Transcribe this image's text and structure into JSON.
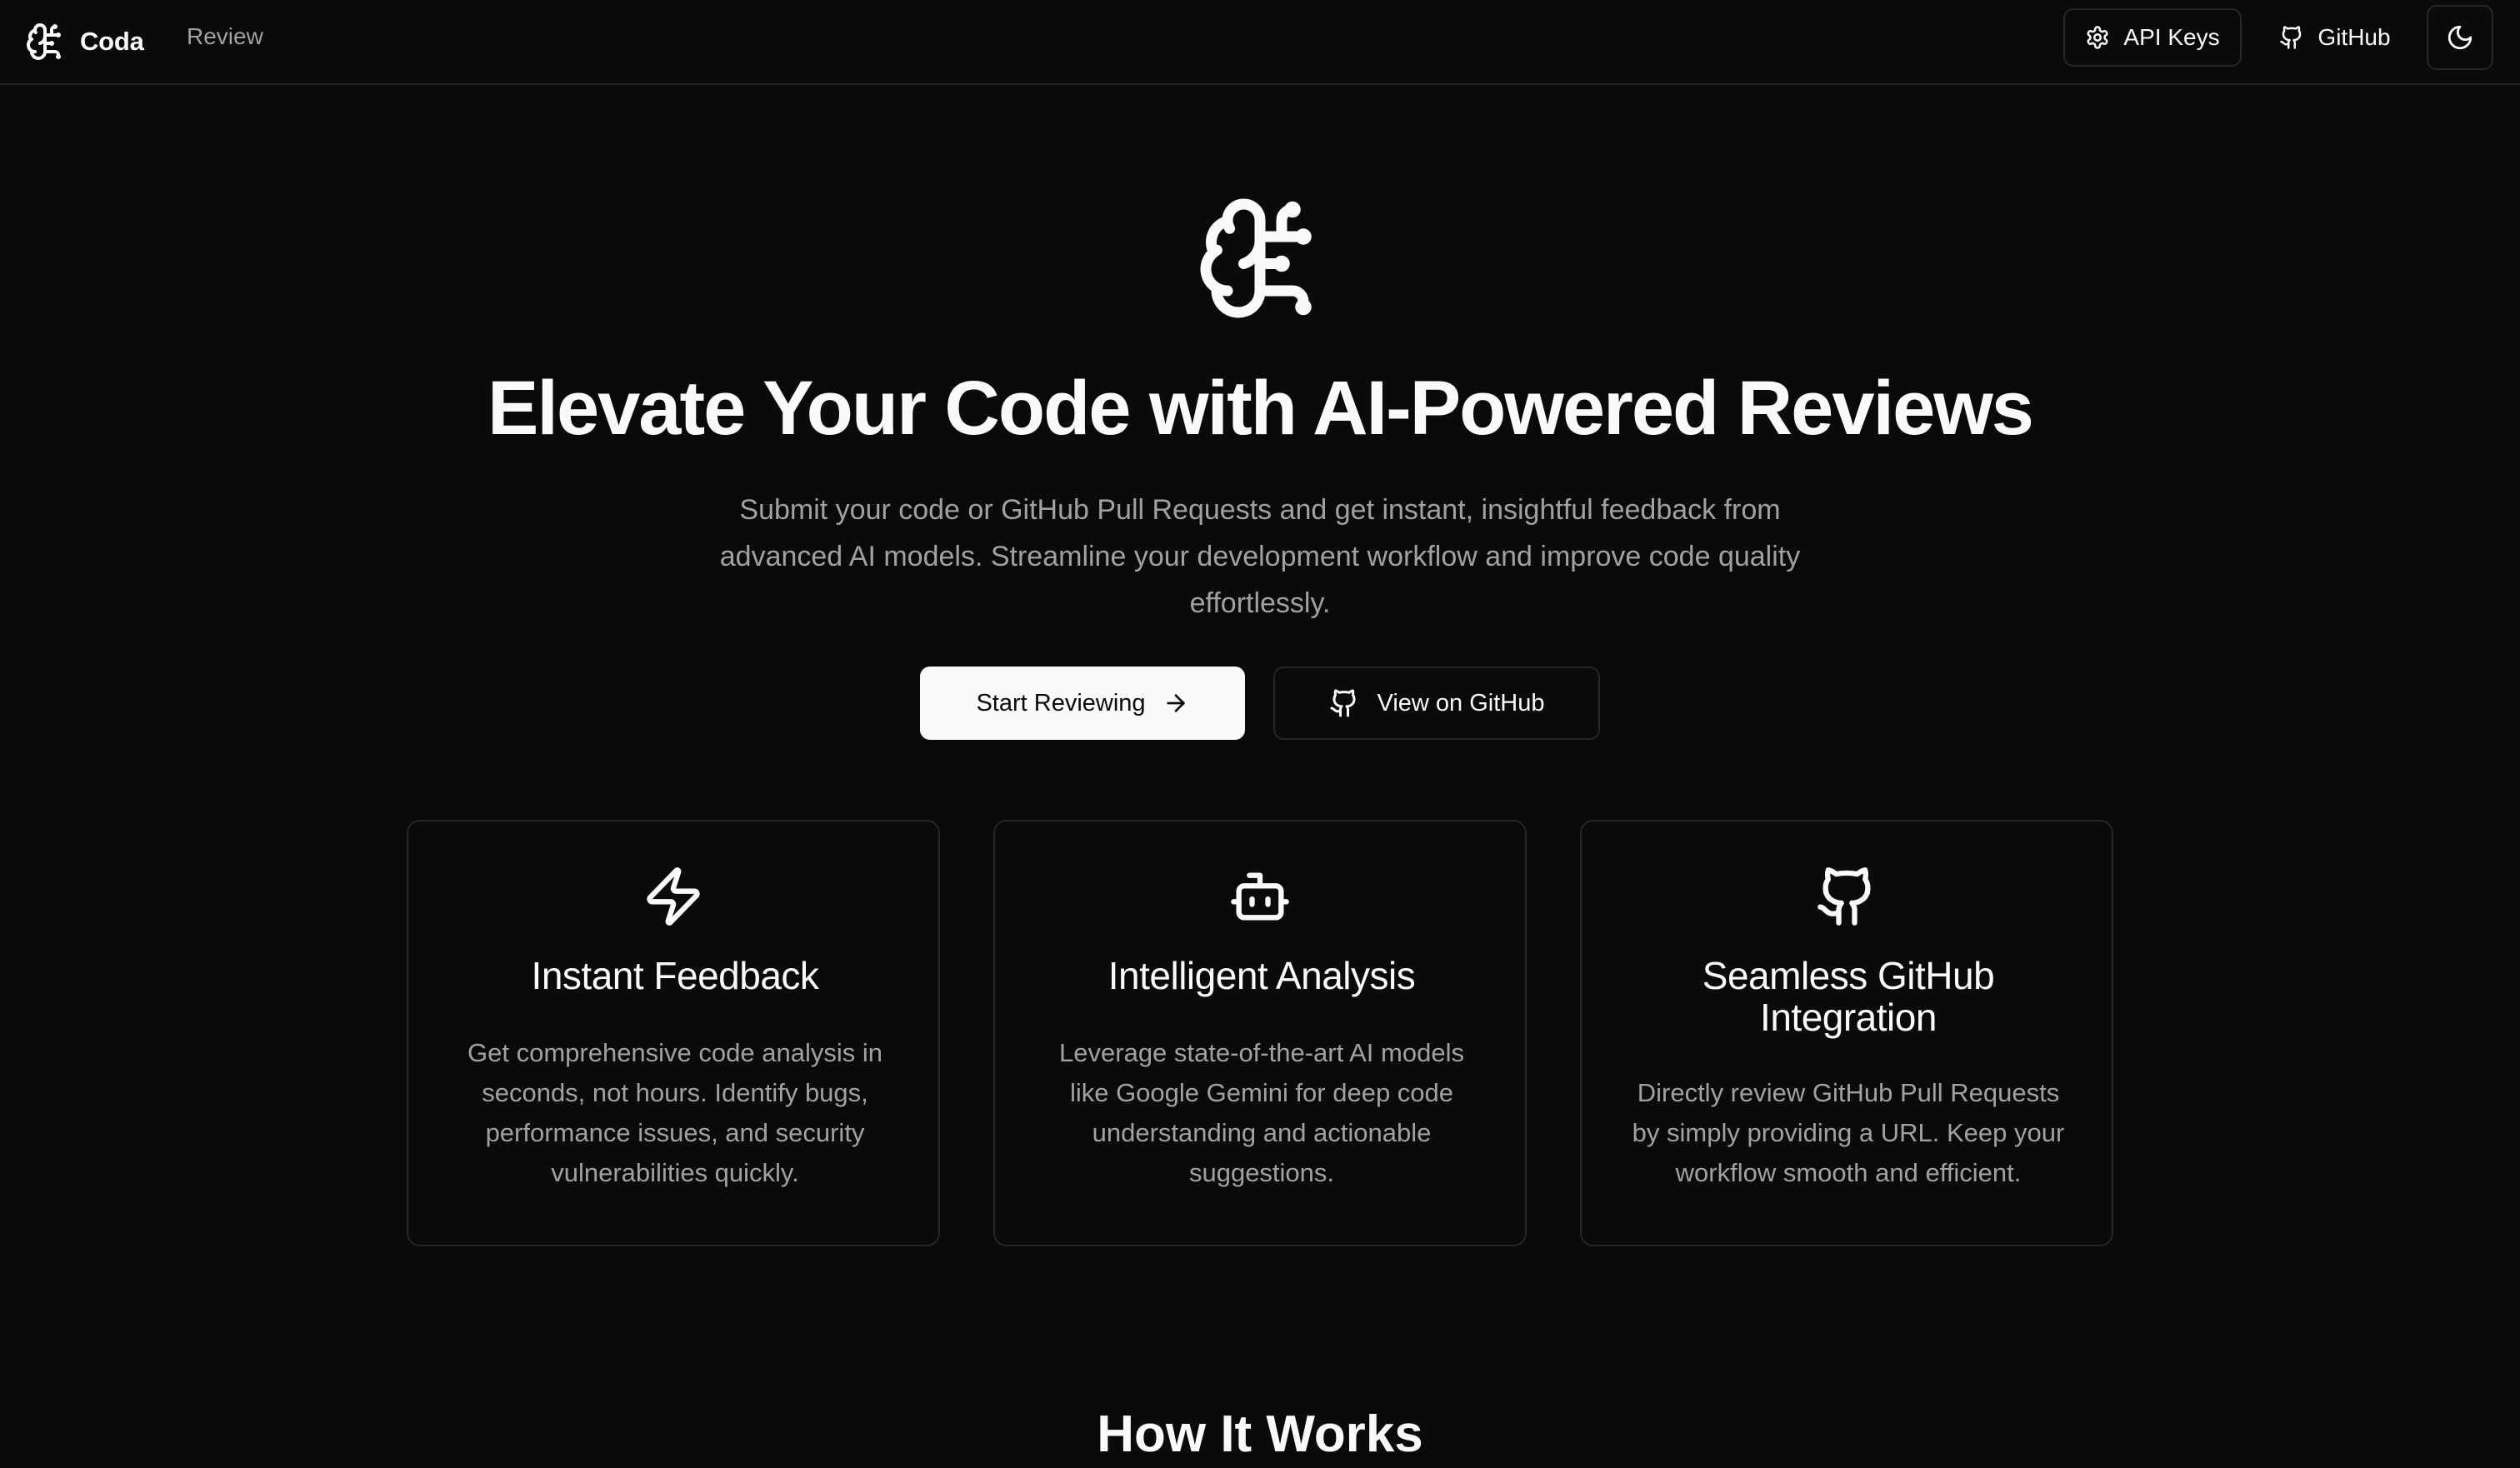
{
  "header": {
    "brand_name": "Coda",
    "nav_review": "Review",
    "api_keys_label": "API Keys",
    "github_label": "GitHub",
    "theme_icon": "moon-icon"
  },
  "hero": {
    "icon": "brain-circuit-icon",
    "title": "Elevate Your Code with AI-Powered Reviews",
    "subtitle": "Submit your code or GitHub Pull Requests and get instant, insightful feedback from advanced AI models. Streamline your development workflow and improve code quality effortlessly.",
    "primary_button": "Start Reviewing",
    "secondary_button": "View on GitHub"
  },
  "features": [
    {
      "icon": "zap-icon",
      "title": "Instant Feedback",
      "description": "Get comprehensive code analysis in seconds, not hours. Identify bugs, performance issues, and security vulnerabilities quickly."
    },
    {
      "icon": "bot-icon",
      "title": "Intelligent Analysis",
      "description": "Leverage state-of-the-art AI models like Google Gemini for deep code understanding and actionable suggestions."
    },
    {
      "icon": "github-icon",
      "title": "Seamless GitHub Integration",
      "description": "Directly review GitHub Pull Requests by simply providing a URL. Keep your workflow smooth and efficient."
    }
  ],
  "how_it_works": {
    "title": "How It Works"
  },
  "colors": {
    "background": "#0a0a0a",
    "border": "#262626",
    "foreground": "#fafafa",
    "muted": "#a1a1a1"
  }
}
